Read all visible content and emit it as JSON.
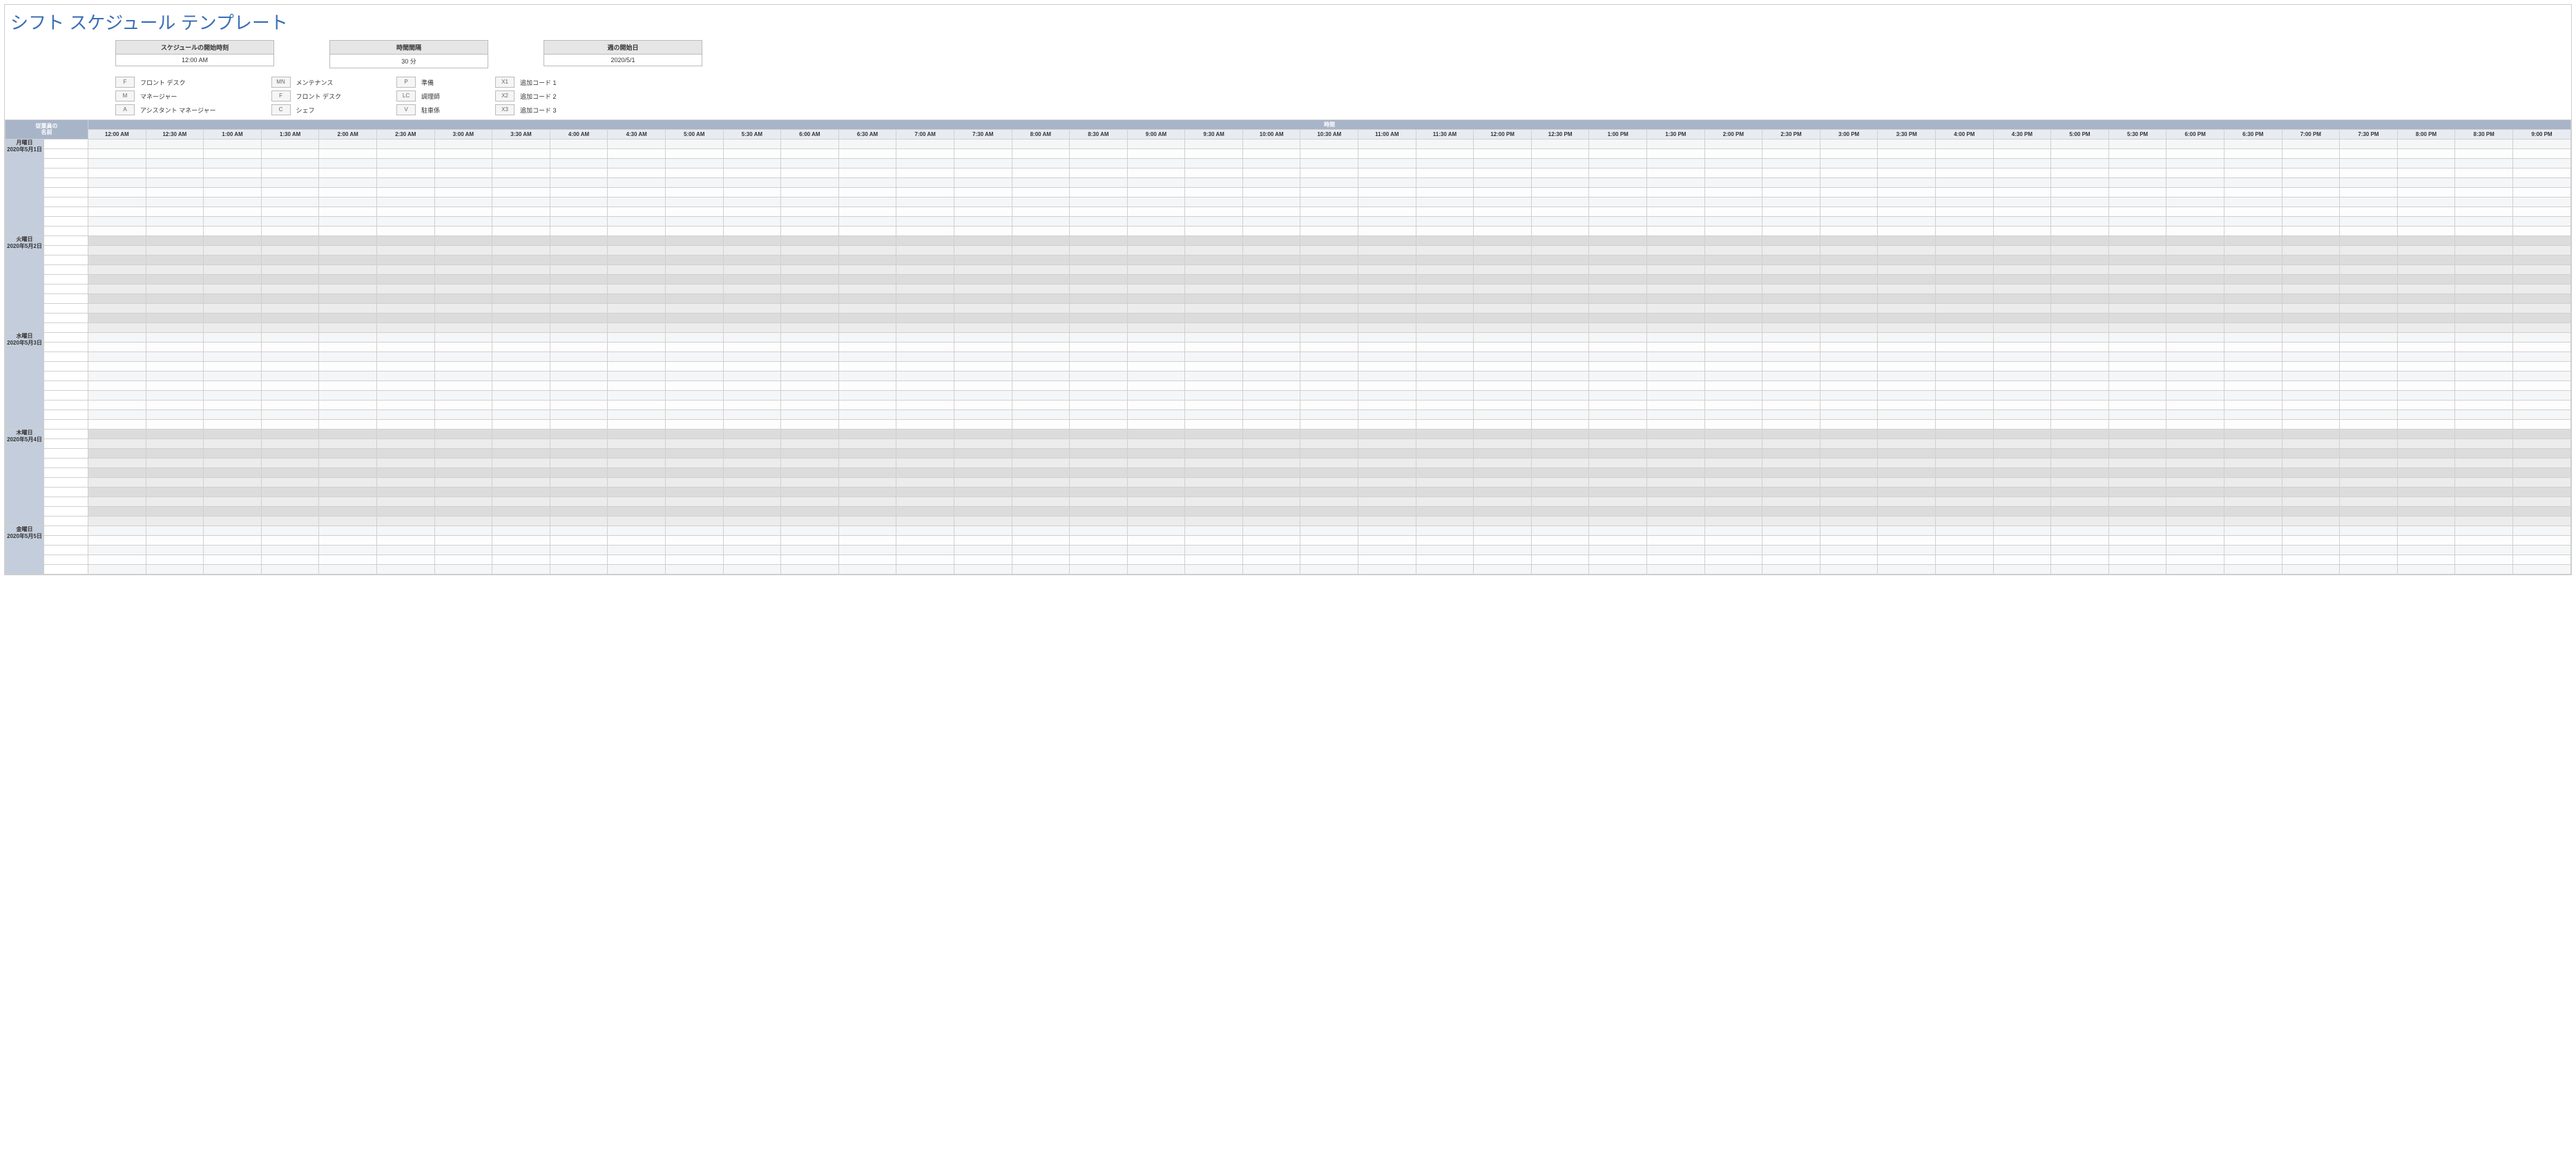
{
  "title": "シフト スケジュール テンプレート",
  "config": {
    "start_time_label": "スケジュールの開始時刻",
    "start_time_value": "12:00 AM",
    "interval_label": "時間間隔",
    "interval_value": "30 分",
    "week_start_label": "週の開始日",
    "week_start_value": "2020/5/1"
  },
  "legend": [
    [
      {
        "code": "F",
        "label": "フロント デスク"
      },
      {
        "code": "M",
        "label": "マネージャー"
      },
      {
        "code": "A",
        "label": "アシスタント マネージャー"
      }
    ],
    [
      {
        "code": "MN",
        "label": "メンテナンス"
      },
      {
        "code": "F",
        "label": "フロント デスク"
      },
      {
        "code": "C",
        "label": "シェフ"
      }
    ],
    [
      {
        "code": "P",
        "label": "準備"
      },
      {
        "code": "LC",
        "label": "調理師"
      },
      {
        "code": "V",
        "label": "駐車係"
      }
    ],
    [
      {
        "code": "X1",
        "label": "追加コード 1"
      },
      {
        "code": "X2",
        "label": "追加コード 2"
      },
      {
        "code": "X3",
        "label": "追加コード 3"
      }
    ]
  ],
  "grid": {
    "employee_header_line1": "従業員の",
    "employee_header_line2": "名前",
    "time_banner": "時間",
    "time_columns": [
      "12:00 AM",
      "12:30 AM",
      "1:00 AM",
      "1:30 AM",
      "2:00 AM",
      "2:30 AM",
      "3:00 AM",
      "3:30 AM",
      "4:00 AM",
      "4:30 AM",
      "5:00 AM",
      "5:30 AM",
      "6:00 AM",
      "6:30 AM",
      "7:00 AM",
      "7:30 AM",
      "8:00 AM",
      "8:30 AM",
      "9:00 AM",
      "9:30 AM",
      "10:00 AM",
      "10:30 AM",
      "11:00 AM",
      "11:30 AM",
      "12:00 PM",
      "12:30 PM",
      "1:00 PM",
      "1:30 PM",
      "2:00 PM",
      "2:30 PM",
      "3:00 PM",
      "3:30 PM",
      "4:00 PM",
      "4:30 PM",
      "5:00 PM",
      "5:30 PM",
      "6:00 PM",
      "6:30 PM",
      "7:00 PM",
      "7:30 PM",
      "8:00 PM",
      "8:30 PM",
      "9:00 PM"
    ],
    "days": [
      {
        "name": "月曜日",
        "date": "2020年5月1日",
        "tone": "light",
        "rows": 10
      },
      {
        "name": "火曜日",
        "date": "2020年5月2日",
        "tone": "dark",
        "rows": 10
      },
      {
        "name": "水曜日",
        "date": "2020年5月3日",
        "tone": "light",
        "rows": 10
      },
      {
        "name": "木曜日",
        "date": "2020年5月4日",
        "tone": "dark",
        "rows": 10
      },
      {
        "name": "金曜日",
        "date": "2020年5月5日",
        "tone": "light",
        "rows": 5
      }
    ]
  }
}
